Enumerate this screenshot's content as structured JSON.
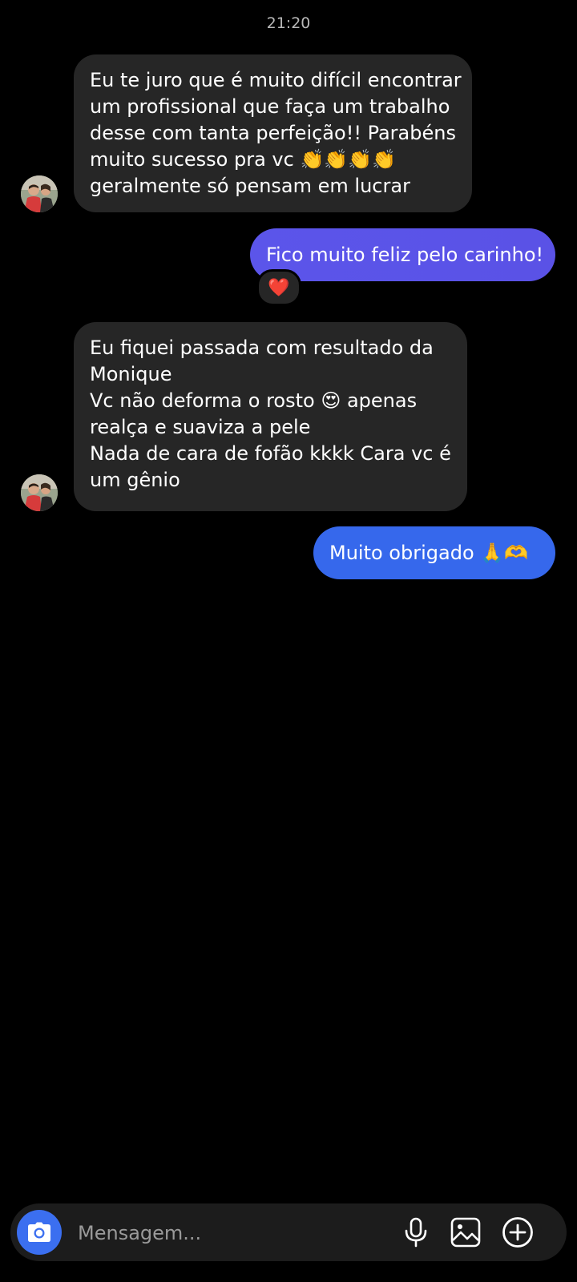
{
  "timestamp": "21:20",
  "messages": [
    {
      "direction": "incoming",
      "lines": [
        "Eu te juro que é muito difícil encontrar",
        "um profissional que faça um trabalho",
        "desse com tanta perfeição!! Parabéns",
        "muito sucesso pra vc 👏👏👏👏",
        "geralmente só pensam em lucrar"
      ]
    },
    {
      "direction": "outgoing",
      "text": "Fico muito feliz pelo carinho!",
      "reaction": "❤️"
    },
    {
      "direction": "incoming",
      "lines": [
        "Eu fiquei passada com resultado da",
        "Monique",
        "Vc não deforma o rosto 😍 apenas",
        "realça e suaviza a pele",
        "Nada de cara de fofão kkkk Cara vc é",
        "um gênio"
      ]
    },
    {
      "direction": "outgoing",
      "text": "Muito obrigado 🙏🫶"
    }
  ],
  "colors": {
    "outgoing_bubble_1": "#5a55ea",
    "outgoing_bubble_2": "#3668ec",
    "incoming_bubble": "#262626",
    "camera_button": "#3b6ff0"
  },
  "composer": {
    "placeholder": "Mensagem...",
    "icons": [
      "camera-icon",
      "microphone-icon",
      "gallery-icon",
      "add-icon"
    ]
  }
}
